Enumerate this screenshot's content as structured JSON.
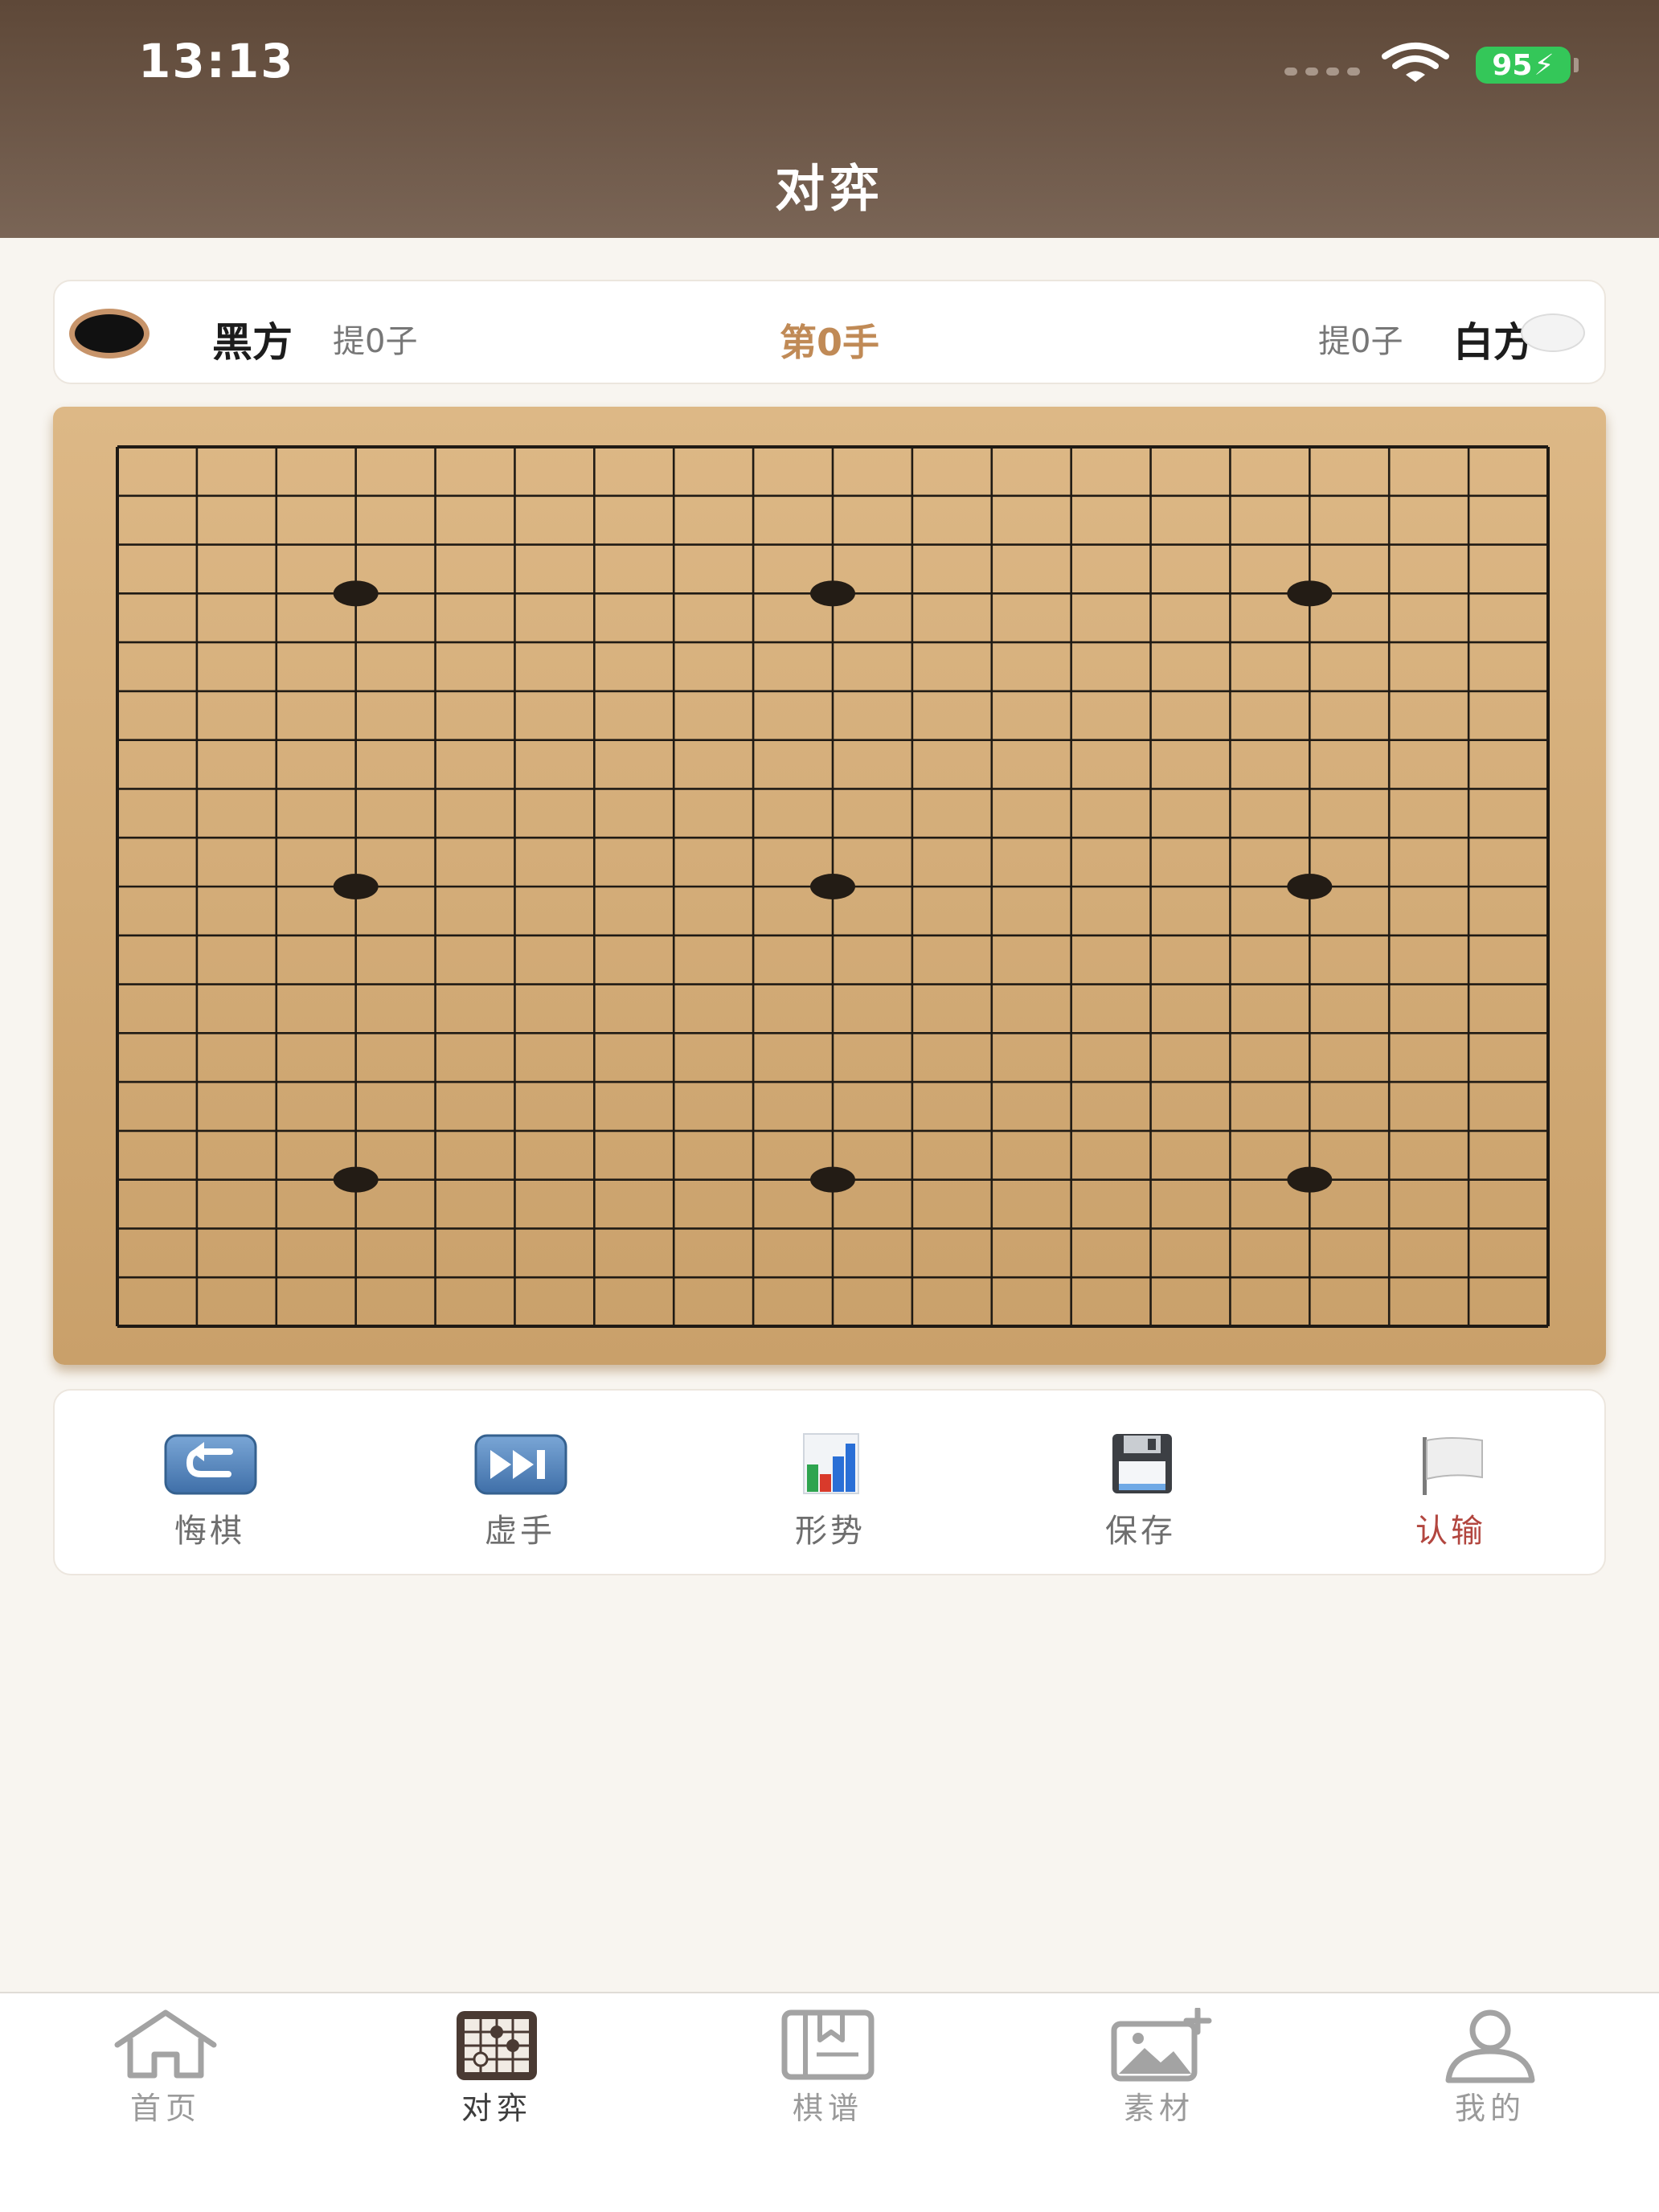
{
  "status_bar": {
    "time": "13:13",
    "battery": "95"
  },
  "header": {
    "title": "对弈"
  },
  "players": {
    "black": {
      "label": "黑方",
      "captured": "提0子"
    },
    "move": "第0手",
    "white": {
      "label": "白方",
      "captured": "提0子"
    }
  },
  "board": {
    "size": 19,
    "star_points": [
      [
        3,
        3
      ],
      [
        3,
        9
      ],
      [
        3,
        15
      ],
      [
        9,
        3
      ],
      [
        9,
        9
      ],
      [
        9,
        15
      ],
      [
        15,
        3
      ],
      [
        15,
        9
      ],
      [
        15,
        15
      ]
    ]
  },
  "toolbar": {
    "undo_label": "悔棋",
    "pass_label": "虚手",
    "situation_label": "形势",
    "save_label": "保存",
    "resign_label": "认输"
  },
  "tabs": [
    {
      "label": "首页",
      "icon": "home-icon"
    },
    {
      "label": "对弈",
      "icon": "go-board-icon"
    },
    {
      "label": "棋谱",
      "icon": "game-record-icon"
    },
    {
      "label": "素材",
      "icon": "image-add-icon"
    },
    {
      "label": "我的",
      "icon": "user-icon"
    }
  ],
  "colors": {
    "header_top": "#5e4838",
    "header_bottom": "#7a6556",
    "board_top": "#ddb886",
    "board_bottom": "#c9a06a",
    "move_accent": "#c08a56",
    "resign_red": "#b2463f",
    "battery_green": "#34c759"
  }
}
